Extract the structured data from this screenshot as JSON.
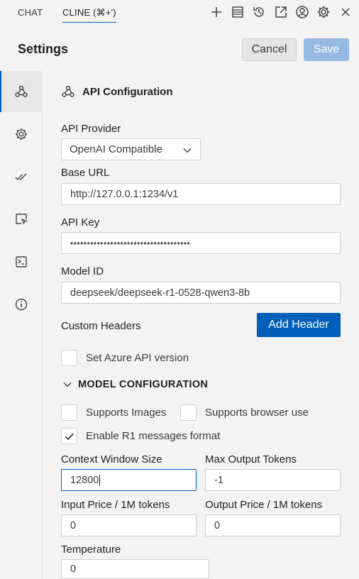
{
  "tabs": {
    "chat": "CHAT",
    "cline": "CLINE (⌘+')"
  },
  "toolbar_icons": [
    "plus-icon",
    "history-list-icon",
    "history-clock-icon",
    "popout-icon",
    "account-icon",
    "settings-gear-icon",
    "close-icon"
  ],
  "header": {
    "title": "Settings",
    "cancel_label": "Cancel",
    "save_label": "Save"
  },
  "sidebar": {
    "items": [
      {
        "name": "api-configuration",
        "icon": "webhook-icon",
        "active": true
      },
      {
        "name": "general",
        "icon": "gear-icon",
        "active": false
      },
      {
        "name": "features",
        "icon": "double-check-icon",
        "active": false
      },
      {
        "name": "browser",
        "icon": "cursor-box-icon",
        "active": false
      },
      {
        "name": "terminal",
        "icon": "terminal-icon",
        "active": false
      },
      {
        "name": "about",
        "icon": "info-icon",
        "active": false
      }
    ]
  },
  "section": {
    "title": "API Configuration"
  },
  "api_provider": {
    "label": "API Provider",
    "value": "OpenAI Compatible"
  },
  "base_url": {
    "label": "Base URL",
    "value": "http://127.0.0.1:1234/v1"
  },
  "api_key": {
    "label": "API Key",
    "value": "••••••••••••••••••••••••••••••••••••"
  },
  "model_id": {
    "label": "Model ID",
    "value": "deepseek/deepseek-r1-0528-qwen3-8b"
  },
  "custom_headers": {
    "label": "Custom Headers",
    "add_label": "Add Header"
  },
  "azure": {
    "label": "Set Azure API version",
    "checked": false
  },
  "model_config": {
    "title": "MODEL CONFIGURATION",
    "supports_images": {
      "label": "Supports Images",
      "checked": false
    },
    "supports_browser": {
      "label": "Supports browser use",
      "checked": false
    },
    "r1_format": {
      "label": "Enable R1 messages format",
      "checked": true
    },
    "context_window": {
      "label": "Context Window Size",
      "value": "12800"
    },
    "max_output": {
      "label": "Max Output Tokens",
      "value": "-1"
    },
    "input_price": {
      "label": "Input Price / 1M tokens",
      "value": "0"
    },
    "output_price": {
      "label": "Output Price / 1M tokens",
      "value": "0"
    },
    "temperature": {
      "label": "Temperature",
      "value": "0"
    }
  },
  "colors": {
    "accent": "#005fb8",
    "save_disabled": "#95b9e3",
    "background": "#f3f3f3"
  }
}
